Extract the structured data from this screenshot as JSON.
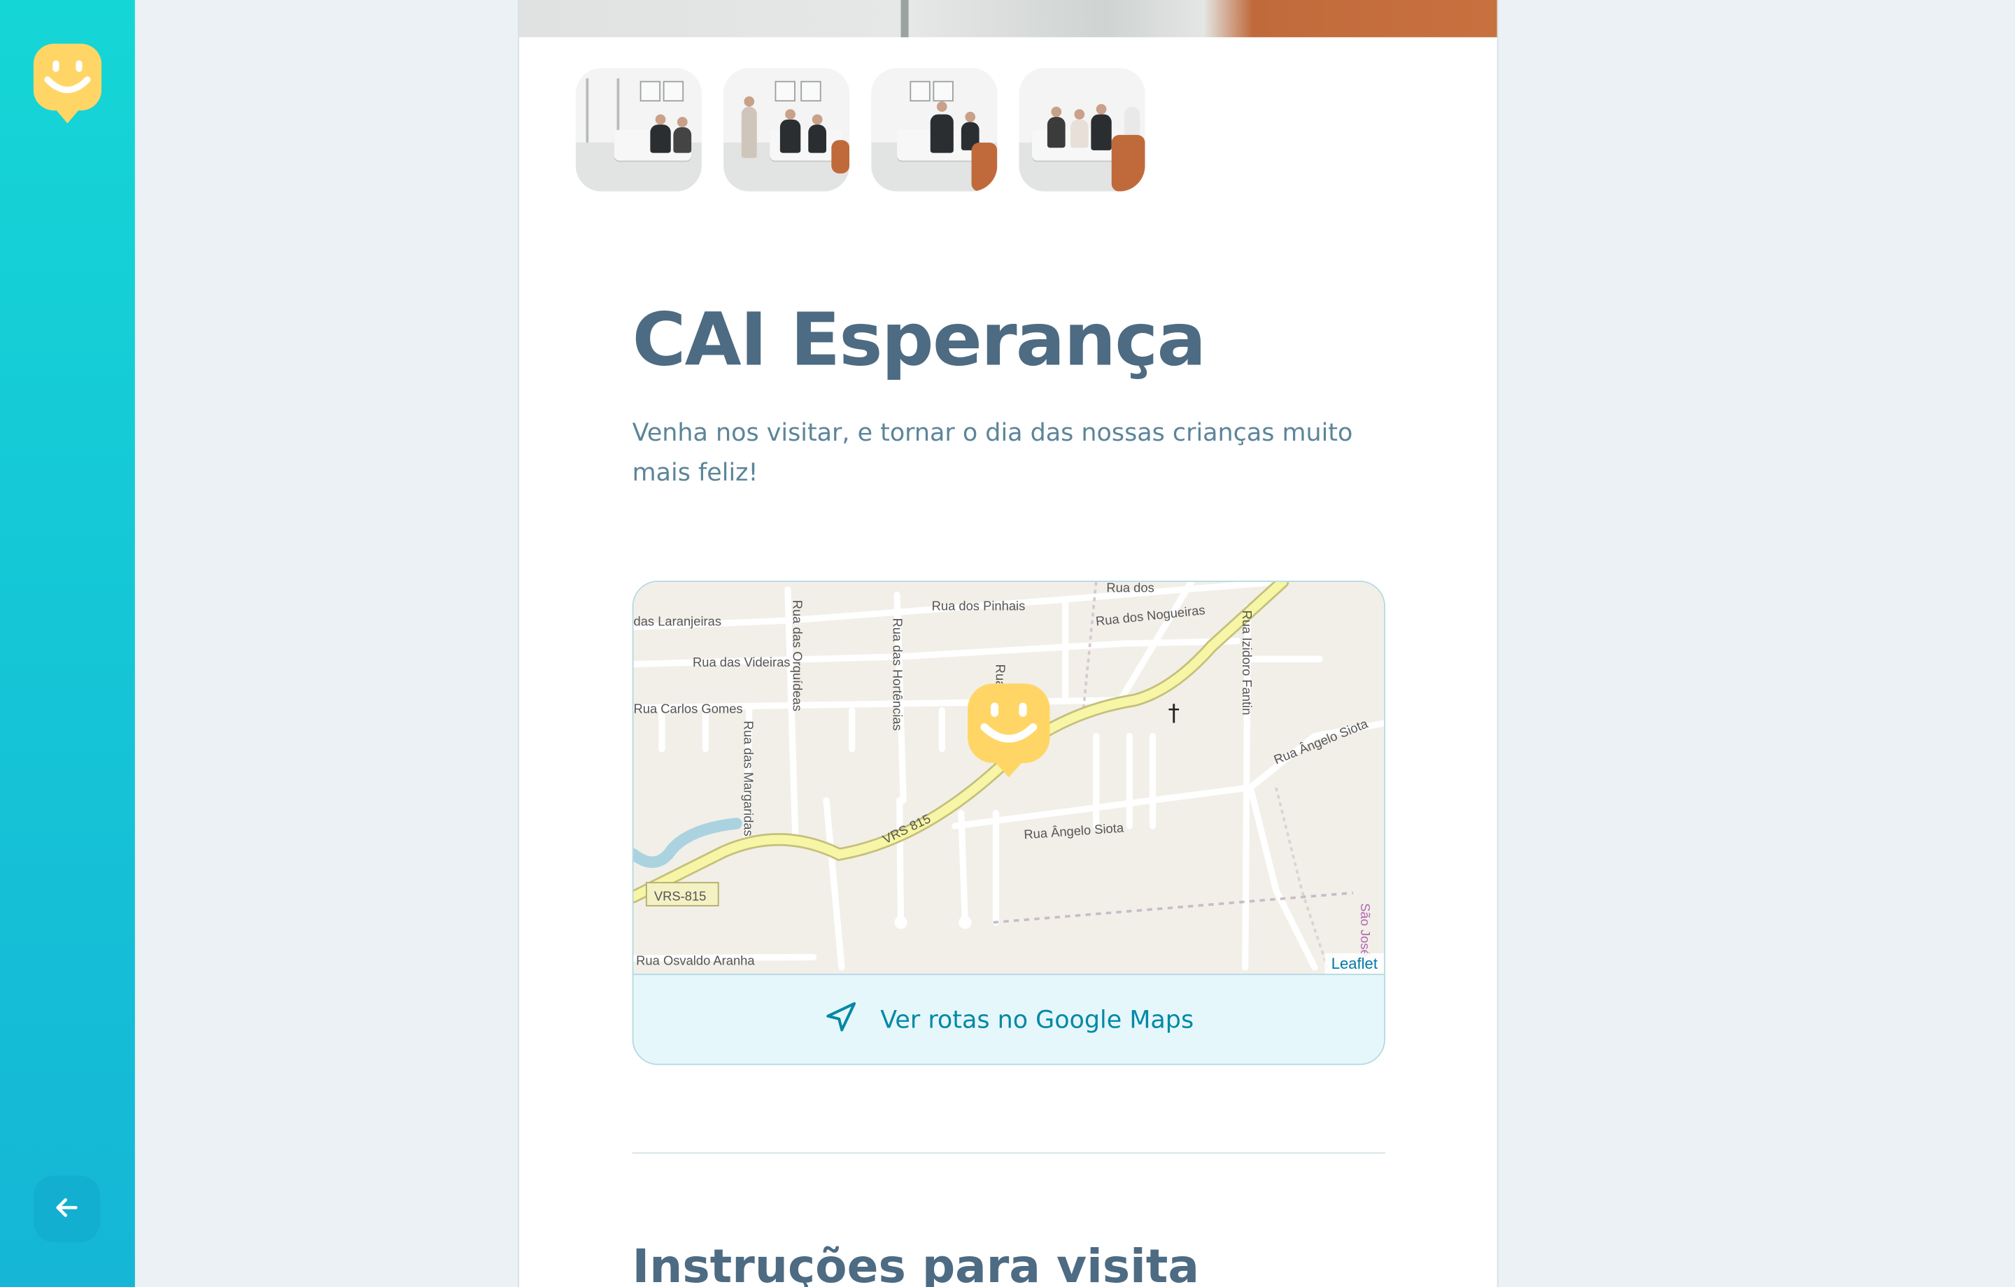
{
  "sidebar": {
    "logo_icon": "smiley-marker-icon",
    "back_icon": "arrow-left-icon",
    "accent_top": "#15d6d6",
    "accent_bottom": "#15b6d6",
    "logo_color": "#ffd666"
  },
  "gallery": {
    "thumbnails": [
      {
        "label": "thumbnail-1"
      },
      {
        "label": "thumbnail-2"
      },
      {
        "label": "thumbnail-3"
      },
      {
        "label": "thumbnail-4"
      }
    ]
  },
  "orphanage": {
    "name": "CAI Esperança",
    "about": "Venha nos visitar, e tornar o dia das nossas crianças muito mais feliz!"
  },
  "map": {
    "attribution": "Leaflet",
    "streets": [
      "Rua dos Pinhais",
      "Rua dos Nogueiras",
      "Rua dos",
      "das Laranjeiras",
      "Rua das Videiras",
      "Rua Carlos Gomes",
      "Rua das Orquídeas",
      "Rua das Hortências",
      "Rua das Margaridas",
      "Rua",
      "Rua Izidoro Fantin",
      "Rua Ângelo Siota",
      "Rua Ângelo Siota",
      "VRS 815",
      "VRS-815",
      "Rua Osvaldo Aranha",
      "São José"
    ],
    "marker_icon": "smiley-marker-icon"
  },
  "routes": {
    "label": "Ver rotas no Google Maps",
    "icon": "navigation-arrow-icon"
  },
  "instructions": {
    "title": "Instruções para visita"
  }
}
